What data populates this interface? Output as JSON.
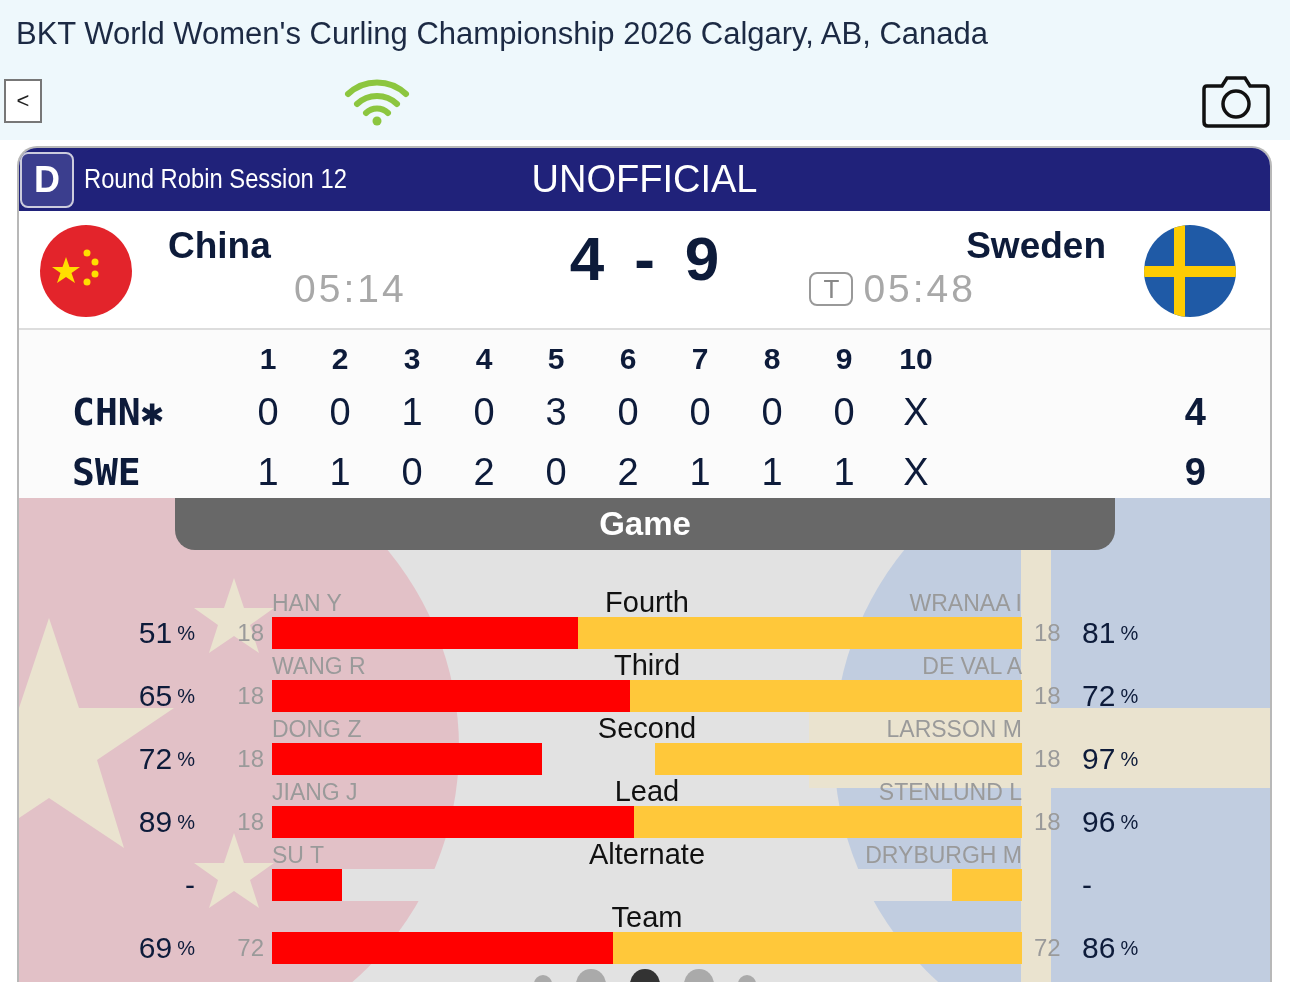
{
  "header": {
    "title": "BKT World Women's Curling Championship 2026 Calgary, AB, Canada",
    "back_button": "<"
  },
  "event": {
    "division": "D",
    "session": "Round Robin Session 12",
    "status": "UNOFFICIAL"
  },
  "teams": [
    {
      "name": "China",
      "time": "05:14",
      "kind": "china"
    },
    {
      "name": "Sweden",
      "time": "05:48",
      "timeout_label": "T",
      "kind": "sweden"
    }
  ],
  "score": {
    "home": "4",
    "separator": "-",
    "away": "9"
  },
  "linescore": {
    "ends": [
      "1",
      "2",
      "3",
      "4",
      "5",
      "6",
      "7",
      "8",
      "9",
      "10"
    ],
    "rows": [
      {
        "team": "CHN✱",
        "ends": [
          "0",
          "0",
          "1",
          "0",
          "3",
          "0",
          "0",
          "0",
          "0",
          "X"
        ],
        "total": "4"
      },
      {
        "team": "SWE",
        "ends": [
          "1",
          "1",
          "0",
          "2",
          "0",
          "2",
          "1",
          "1",
          "1",
          "X"
        ],
        "total": "9"
      }
    ]
  },
  "stats": {
    "tab": "Game",
    "rows": [
      {
        "position": "Fourth",
        "left": {
          "name": "HAN Y",
          "count": "18",
          "pct": "51",
          "unit": "%",
          "level": 0.408
        },
        "right": {
          "name": "WRANAA I",
          "count": "18",
          "pct": "81",
          "unit": "%",
          "level": 0.592
        }
      },
      {
        "position": "Third",
        "left": {
          "name": "WANG R",
          "count": "18",
          "pct": "65",
          "unit": "%",
          "level": 0.477
        },
        "right": {
          "name": "DE VAL A",
          "count": "18",
          "pct": "72",
          "unit": "%",
          "level": 0.523
        }
      },
      {
        "position": "Second",
        "left": {
          "name": "DONG Z",
          "count": "18",
          "pct": "72",
          "unit": "%",
          "level": 0.36
        },
        "right": {
          "name": "LARSSON M",
          "count": "18",
          "pct": "97",
          "unit": "%",
          "level": 0.489
        }
      },
      {
        "position": "Lead",
        "left": {
          "name": "JIANG J",
          "count": "18",
          "pct": "89",
          "unit": "%",
          "level": 0.483
        },
        "right": {
          "name": "STENLUND L",
          "count": "18",
          "pct": "96",
          "unit": "%",
          "level": 0.517
        }
      },
      {
        "position": "Alternate",
        "left": {
          "name": "SU T",
          "pct": "-",
          "level": 0.093
        },
        "right": {
          "name": "DRYBURGH M",
          "pct": "-",
          "level": 0.093
        }
      },
      {
        "position": "Team",
        "left": {
          "count": "72",
          "pct": "69",
          "unit": "%",
          "level": 0.455
        },
        "right": {
          "count": "72",
          "pct": "86",
          "unit": "%",
          "level": 0.545
        }
      }
    ]
  },
  "pages": [
    {
      "selected": false
    },
    {
      "selected": false
    },
    {
      "selected": true
    },
    {
      "selected": false
    },
    {
      "selected": false
    }
  ]
}
